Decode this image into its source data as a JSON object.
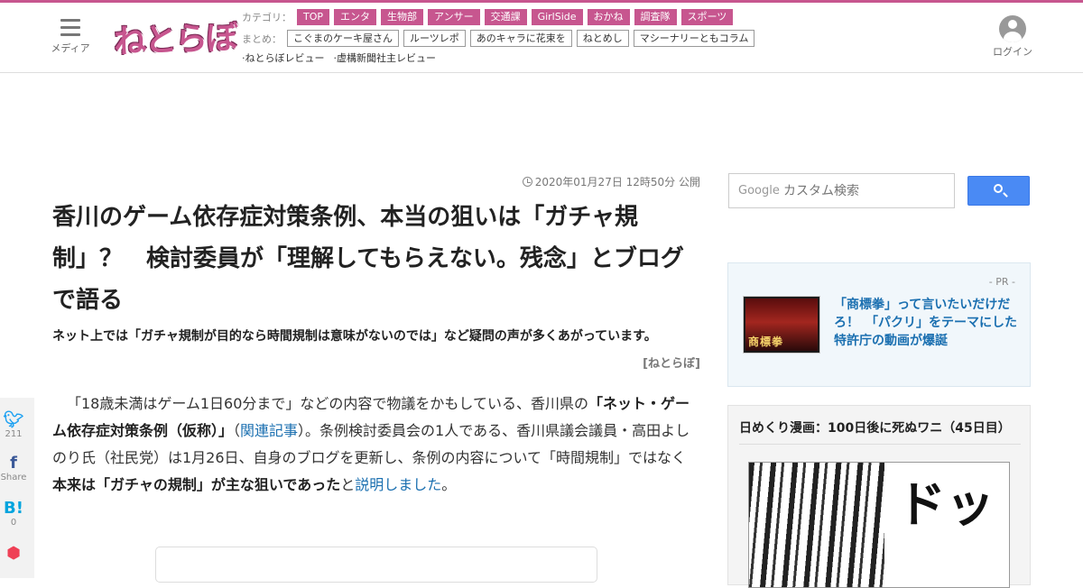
{
  "header": {
    "menu_label": "メディア",
    "logo_text": "ねとらぼ",
    "category_label": "カテゴリ：",
    "categories": [
      "TOP",
      "エンタ",
      "生物部",
      "アンサー",
      "交通課",
      "GirlSide",
      "おかね",
      "調査隊",
      "スポーツ"
    ],
    "matome_label": "まとめ：",
    "matome": [
      "こぐまのケーキ屋さん",
      "ルーツレポ",
      "あのキャラに花束を",
      "ねとめし",
      "マシーナリーともコラム"
    ],
    "reviews": [
      "·ねとらぼレビュー",
      "·虚構新聞社主レビュー"
    ],
    "login_label": "ログイン"
  },
  "article": {
    "timestamp": "2020年01月27日 12時50分 公開",
    "title": "香川のゲーム依存症対策条例、本当の狙いは「ガチャ規制」？　検討委員が「理解してもらえない。残念」とブログで語る",
    "lead": "ネット上では「ガチャ規制が目的なら時間規制は意味がないのでは」など疑問の声が多くあがっています。",
    "credit": "[ねとらぼ]",
    "body": {
      "p1": "「18歳未満はゲーム1日60分まで」などの内容で物議をかもしている、香川県の",
      "b1": "「ネット・ゲーム依存症対策条例（仮称）」",
      "p2": "（",
      "link1": "関連記事",
      "p3": "）。条例検討委員会の1人である、香川県議会議員・高田よしのり氏（社民党）は1月26日、自身のブログを更新し、条例の内容について「時間規制」ではなく",
      "b2": "本来は「ガチャの規制」が主な狙いであった",
      "p4": "と",
      "link2": "説明しました",
      "p5": "。"
    }
  },
  "share": {
    "twitter_count": "211",
    "facebook_label": "Share",
    "hatena_count": "0"
  },
  "sidebar": {
    "search_brand": "Google",
    "search_placeholder": "カスタム検索",
    "pr_tag": "- PR -",
    "pr_thumb_text": "商標拳",
    "pr_title": "「商標拳」って言いたいだけだろ！　「パクリ」をテーマにした特許庁の動画が爆誕",
    "manga_title": "日めくり漫画：100日後に死ぬワニ（45日目）",
    "manga_sfx": "ドッ"
  },
  "colors": {
    "brand": "#c7568f",
    "link": "#1a6fb0",
    "search_button": "#4a8af4"
  }
}
